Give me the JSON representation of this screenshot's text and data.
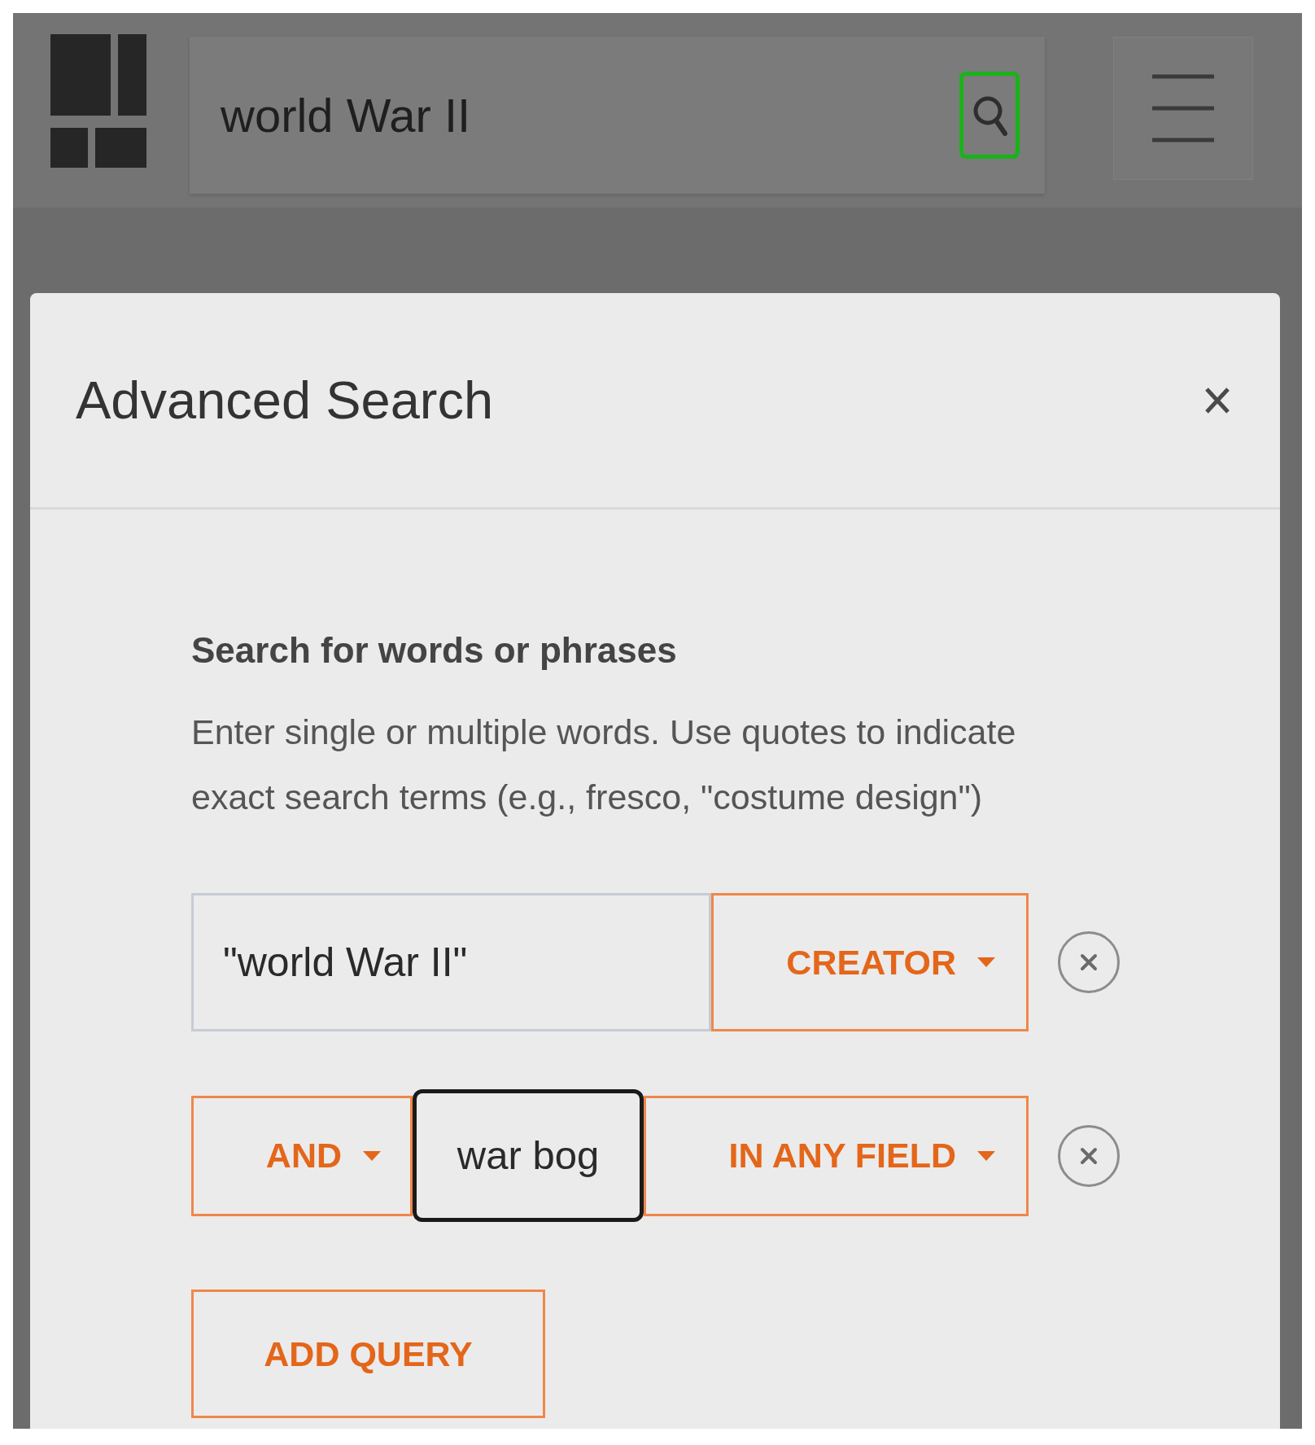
{
  "header": {
    "search": {
      "value": "world War II",
      "button_highlighted": true
    }
  },
  "dialog": {
    "title": "Advanced Search",
    "heading": "Search for words or phrases",
    "help_text": "Enter single or multiple words. Use quotes to indicate exact search terms (e.g., fresco, \"costume design\")",
    "queries": [
      {
        "kind": "first",
        "term": "\"world War II\"",
        "focused": false,
        "field": "CREATOR"
      },
      {
        "kind": "joined",
        "operator": "AND",
        "term": "war bog",
        "focused": true,
        "field": "IN ANY FIELD"
      }
    ],
    "add_button": "ADD QUERY"
  }
}
